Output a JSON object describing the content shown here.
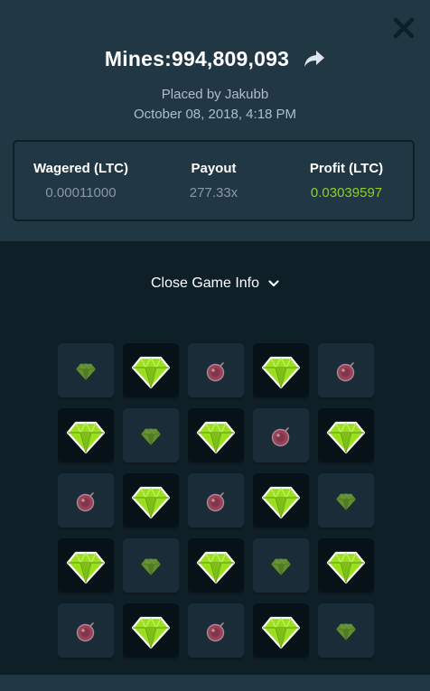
{
  "header": {
    "title": "Mines:994,809,093",
    "placed_by": "Placed by Jakubb",
    "date": "October 08, 2018, 4:18 PM"
  },
  "stats": [
    {
      "label": "Wagered (LTC)",
      "value": "0.00011000"
    },
    {
      "label": "Payout",
      "value": "277.33x"
    },
    {
      "label": "Profit (LTC)",
      "value": "0.03039597"
    }
  ],
  "toggle": {
    "label": "Close Game Info"
  },
  "icons": {
    "close": "close-icon",
    "share": "share-icon",
    "toggle": "chevron-down-icon",
    "gem": "gem-icon",
    "mine": "mine-icon"
  },
  "colors": {
    "header_bg": "#213743",
    "page_bg": "#0f1f28",
    "profit": "#8fcf2c",
    "gem": "#9be01f",
    "mine": "#c24a63"
  },
  "board": [
    [
      "gem-unrevealed",
      "gem",
      "mine",
      "gem",
      "mine"
    ],
    [
      "gem",
      "gem-unrevealed",
      "gem",
      "mine",
      "gem"
    ],
    [
      "mine",
      "gem",
      "mine",
      "gem",
      "gem-unrevealed"
    ],
    [
      "gem",
      "gem-unrevealed",
      "gem",
      "gem-unrevealed",
      "gem"
    ],
    [
      "mine",
      "gem",
      "mine",
      "gem",
      "gem-unrevealed"
    ]
  ]
}
